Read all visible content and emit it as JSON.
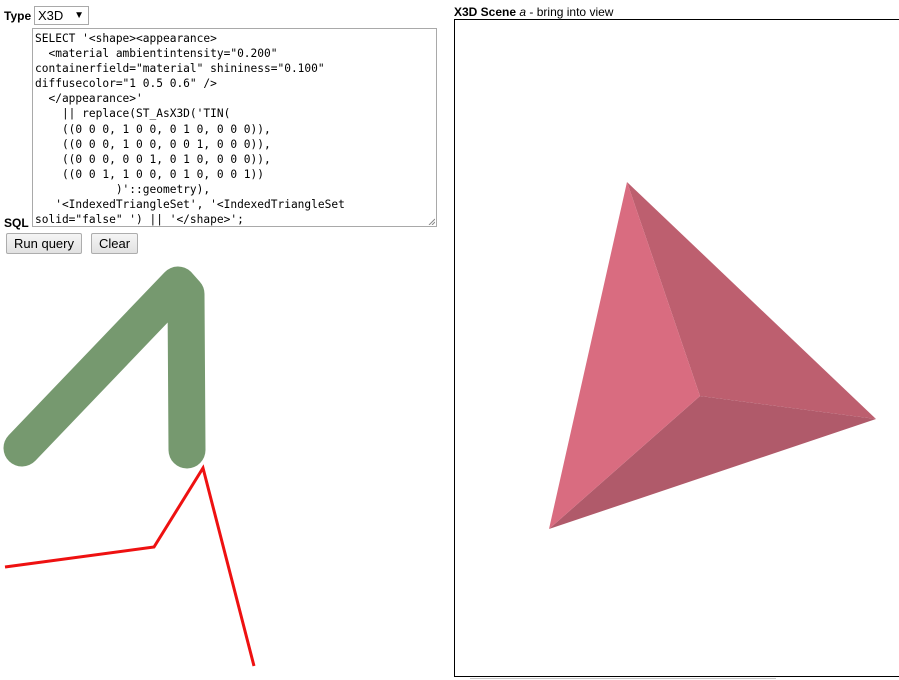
{
  "form": {
    "type_label": "Type",
    "type_value": "X3D",
    "sql_label": "SQL",
    "sql_text": "SELECT '<shape><appearance>\n  <material ambientintensity=\"0.200\"\ncontainerfield=\"material\" shininess=\"0.100\"\ndiffusecolor=\"1 0.5 0.6\" />\n  </appearance>'\n    || replace(ST_AsX3D('TIN(\n    ((0 0 0, 1 0 0, 0 1 0, 0 0 0)),\n    ((0 0 0, 1 0 0, 0 0 1, 0 0 0)),\n    ((0 0 0, 0 0 1, 0 1 0, 0 0 0)),\n    ((0 0 1, 1 0 0, 0 1 0, 0 0 1))\n            )'::geometry),\n   '<IndexedTriangleSet', '<IndexedTriangleSet\nsolid=\"false\" ') || '</shape>';",
    "run_button": "Run query",
    "clear_button": "Clear"
  },
  "scene": {
    "title_bold": "X3D Scene",
    "title_italic": "a",
    "title_rest": " - bring into view"
  },
  "colors": {
    "thick_line": "#76996f",
    "thin_line": "#ee1111",
    "face_light": "#d96c80",
    "face_mid": "#bd5f6f",
    "face_dark": "#b05a6a"
  },
  "icons": {
    "dropdown": "triangle-down-icon",
    "resize": "resize-grip-icon"
  }
}
